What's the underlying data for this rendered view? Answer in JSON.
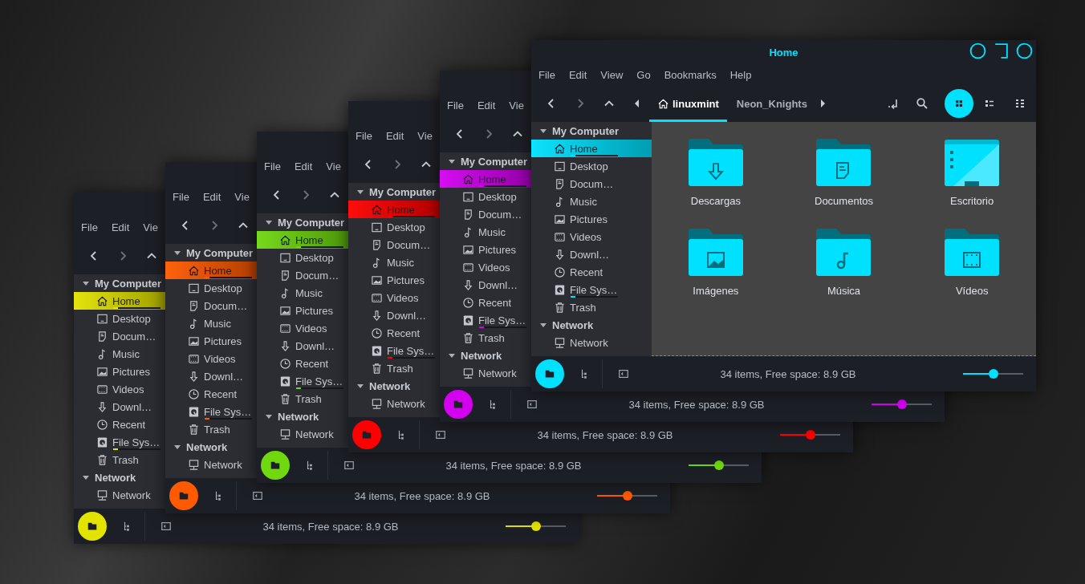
{
  "desktop": {
    "windows": [
      {
        "kind": "back",
        "color": "#e3e300",
        "menu": [
          "File",
          "Edit",
          "Vie"
        ],
        "sidebar": [
          {
            "label": "My Computer",
            "expanded": true,
            "items": [
              {
                "label": "Home",
                "selected": true,
                "level": 0.1
              },
              {
                "label": "Desktop",
                "selected": false
              },
              {
                "label": "Docum…",
                "selected": false
              },
              {
                "label": "Music",
                "selected": false
              },
              {
                "label": "Pictures",
                "selected": false
              },
              {
                "label": "Videos",
                "selected": false
              },
              {
                "label": "Downl…",
                "selected": false
              },
              {
                "label": "Recent",
                "selected": false
              },
              {
                "label": "File Sys…",
                "selected": false,
                "level": 0.1
              },
              {
                "label": "Trash",
                "selected": false
              }
            ]
          },
          {
            "label": "Network",
            "expanded": true,
            "items": [
              {
                "label": "Network",
                "selected": false
              }
            ]
          }
        ],
        "status": {
          "text": "34 items, Free space: 8.9 GB",
          "level": 0.5
        }
      },
      {
        "kind": "back",
        "color": "#ff5a00",
        "menu": [
          "File",
          "Edit",
          "Vie"
        ],
        "sidebar": [
          {
            "label": "My Computer",
            "expanded": true,
            "items": [
              {
                "label": "Home",
                "selected": true,
                "level": 0.1
              },
              {
                "label": "Desktop",
                "selected": false
              },
              {
                "label": "Docum…",
                "selected": false
              },
              {
                "label": "Music",
                "selected": false
              },
              {
                "label": "Pictures",
                "selected": false
              },
              {
                "label": "Videos",
                "selected": false
              },
              {
                "label": "Downl…",
                "selected": false
              },
              {
                "label": "Recent",
                "selected": false
              },
              {
                "label": "File Sys…",
                "selected": false,
                "level": 0.1
              },
              {
                "label": "Trash",
                "selected": false
              }
            ]
          },
          {
            "label": "Network",
            "expanded": true,
            "items": [
              {
                "label": "Network",
                "selected": false
              }
            ]
          }
        ],
        "status": {
          "text": "34 items, Free space: 8.9 GB",
          "level": 0.5
        }
      },
      {
        "kind": "back",
        "color": "#6fd80f",
        "menu": [
          "File",
          "Edit",
          "Vie"
        ],
        "sidebar": [
          {
            "label": "My Computer",
            "expanded": true,
            "items": [
              {
                "label": "Home",
                "selected": true,
                "level": 0.1
              },
              {
                "label": "Desktop",
                "selected": false
              },
              {
                "label": "Docum…",
                "selected": false
              },
              {
                "label": "Music",
                "selected": false
              },
              {
                "label": "Pictures",
                "selected": false
              },
              {
                "label": "Videos",
                "selected": false
              },
              {
                "label": "Downl…",
                "selected": false
              },
              {
                "label": "Recent",
                "selected": false
              },
              {
                "label": "File Sys…",
                "selected": false,
                "level": 0.1
              },
              {
                "label": "Trash",
                "selected": false
              }
            ]
          },
          {
            "label": "Network",
            "expanded": true,
            "items": [
              {
                "label": "Network",
                "selected": false
              }
            ]
          }
        ],
        "status": {
          "text": "34 items, Free space: 8.9 GB",
          "level": 0.5
        }
      },
      {
        "kind": "back",
        "color": "#ff0000",
        "menu": [
          "File",
          "Edit",
          "Vie"
        ],
        "sidebar": [
          {
            "label": "My Computer",
            "expanded": true,
            "items": [
              {
                "label": "Home",
                "selected": true,
                "level": 0.1
              },
              {
                "label": "Desktop",
                "selected": false
              },
              {
                "label": "Docum…",
                "selected": false
              },
              {
                "label": "Music",
                "selected": false
              },
              {
                "label": "Pictures",
                "selected": false
              },
              {
                "label": "Videos",
                "selected": false
              },
              {
                "label": "Downl…",
                "selected": false
              },
              {
                "label": "Recent",
                "selected": false
              },
              {
                "label": "File Sys…",
                "selected": false,
                "level": 0.1
              },
              {
                "label": "Trash",
                "selected": false
              }
            ]
          },
          {
            "label": "Network",
            "expanded": true,
            "items": [
              {
                "label": "Network",
                "selected": false
              }
            ]
          }
        ],
        "status": {
          "text": "34 items, Free space: 8.9 GB",
          "level": 0.5
        }
      },
      {
        "kind": "back",
        "color": "#d400f0",
        "menu": [
          "File",
          "Edit",
          "Vie"
        ],
        "sidebar": [
          {
            "label": "My Computer",
            "expanded": true,
            "items": [
              {
                "label": "Home",
                "selected": true,
                "level": 0.1
              },
              {
                "label": "Desktop",
                "selected": false
              },
              {
                "label": "Docum…",
                "selected": false
              },
              {
                "label": "Music",
                "selected": false
              },
              {
                "label": "Pictures",
                "selected": false
              },
              {
                "label": "Videos",
                "selected": false
              },
              {
                "label": "Downl…",
                "selected": false
              },
              {
                "label": "Recent",
                "selected": false
              },
              {
                "label": "File Sys…",
                "selected": false,
                "level": 0.1
              },
              {
                "label": "Trash",
                "selected": false
              }
            ]
          },
          {
            "label": "Network",
            "expanded": true,
            "items": [
              {
                "label": "Network",
                "selected": false
              }
            ]
          }
        ],
        "status": {
          "text": "34 items, Free space: 8.9 GB",
          "level": 0.5
        }
      },
      {
        "kind": "front",
        "title": "Home",
        "color": "#00e1ff",
        "menu": [
          "File",
          "Edit",
          "View",
          "Go",
          "Bookmarks",
          "Help"
        ],
        "path": [
          {
            "label": "linuxmint",
            "selected": true
          },
          {
            "label": "Neon_Knights",
            "selected": false
          }
        ],
        "views": [
          {
            "selected": true
          },
          {
            "selected": false
          },
          {
            "selected": false
          }
        ],
        "files": [
          {
            "label": "Descargas"
          },
          {
            "label": "Documentos"
          },
          {
            "label": "Escritorio"
          },
          {
            "label": "Imágenes"
          },
          {
            "label": "Música"
          },
          {
            "label": "Vídeos"
          }
        ],
        "sidebar": [
          {
            "label": "My Computer",
            "expanded": true,
            "items": [
              {
                "label": "Home",
                "selected": true,
                "level": 0.1
              },
              {
                "label": "Desktop",
                "selected": false
              },
              {
                "label": "Docum…",
                "selected": false
              },
              {
                "label": "Music",
                "selected": false
              },
              {
                "label": "Pictures",
                "selected": false
              },
              {
                "label": "Videos",
                "selected": false
              },
              {
                "label": "Downl…",
                "selected": false
              },
              {
                "label": "Recent",
                "selected": false
              },
              {
                "label": "File Sys…",
                "selected": false,
                "level": 0.1
              },
              {
                "label": "Trash",
                "selected": false
              }
            ]
          },
          {
            "label": "Network",
            "expanded": true,
            "items": [
              {
                "label": "Network",
                "selected": false
              }
            ]
          }
        ],
        "status": {
          "text": "34 items, Free space: 8.9 GB",
          "level": 0.5
        }
      }
    ]
  }
}
